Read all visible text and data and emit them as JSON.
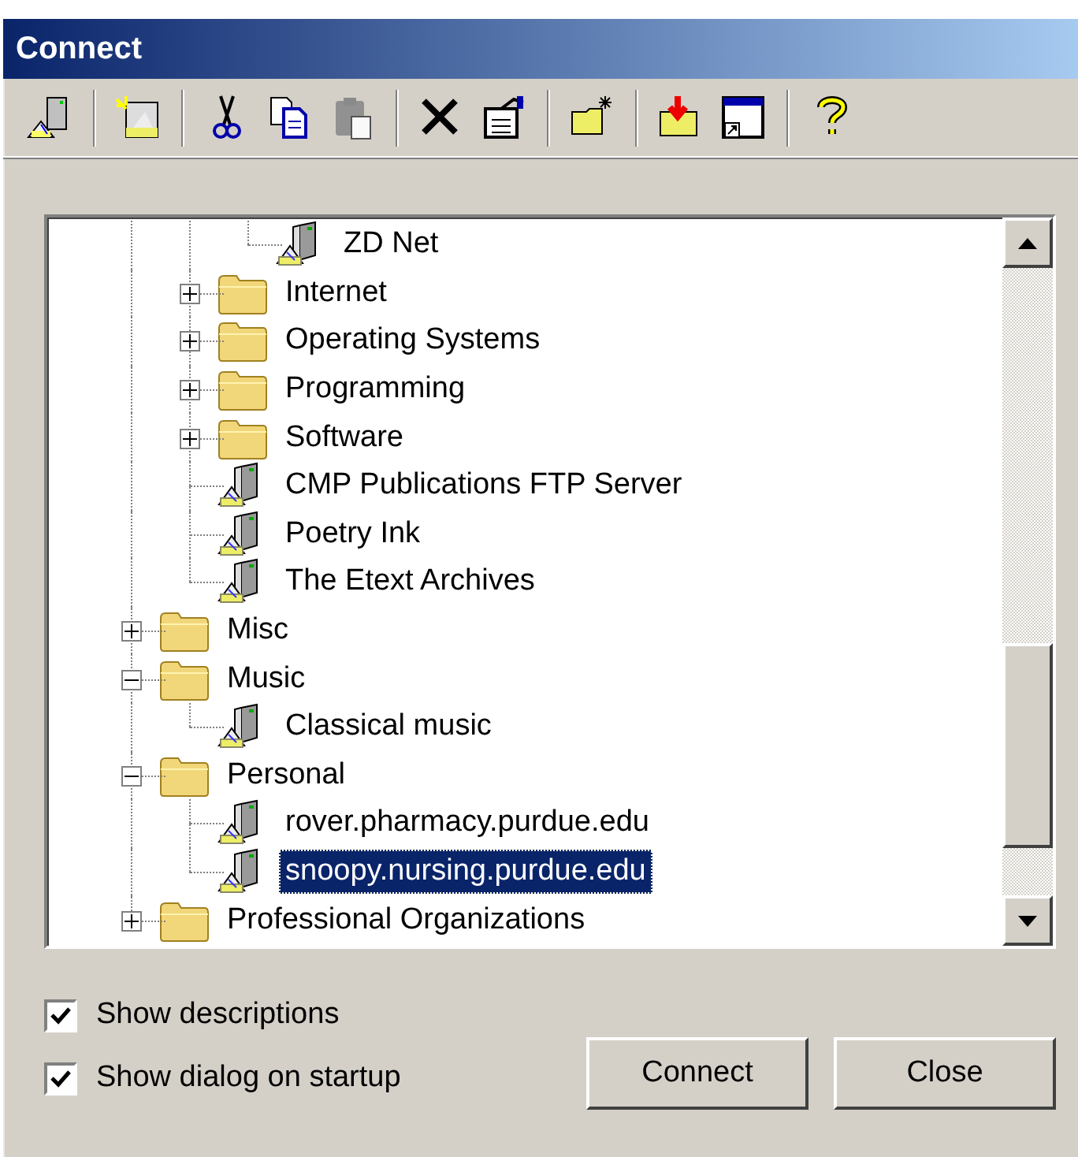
{
  "window": {
    "title": "Connect"
  },
  "toolbar": [
    {
      "kind": "server",
      "disabled": false
    },
    {
      "kind": "separator"
    },
    {
      "kind": "new-server",
      "disabled": false
    },
    {
      "kind": "separator"
    },
    {
      "kind": "cut",
      "disabled": false
    },
    {
      "kind": "copy",
      "disabled": false
    },
    {
      "kind": "paste",
      "disabled": true
    },
    {
      "kind": "separator"
    },
    {
      "kind": "delete",
      "disabled": false
    },
    {
      "kind": "properties",
      "disabled": false
    },
    {
      "kind": "separator"
    },
    {
      "kind": "new-folder",
      "disabled": false
    },
    {
      "kind": "separator"
    },
    {
      "kind": "import",
      "disabled": false
    },
    {
      "kind": "shortcut",
      "disabled": false
    },
    {
      "kind": "separator"
    },
    {
      "kind": "help",
      "disabled": false
    }
  ],
  "tree": {
    "items": [
      {
        "kind": "continued",
        "children": [
          {
            "kind": "continued",
            "children": [
              {
                "kind": "server",
                "label": "ZD Net",
                "selected": false
              }
            ]
          },
          {
            "kind": "folder",
            "label": "Internet",
            "expanded": false,
            "selected": false
          },
          {
            "kind": "folder",
            "label": "Operating Systems",
            "expanded": false,
            "selected": false
          },
          {
            "kind": "folder",
            "label": "Programming",
            "expanded": false,
            "selected": false
          },
          {
            "kind": "folder",
            "label": "Software",
            "expanded": false,
            "selected": false
          },
          {
            "kind": "server",
            "label": "CMP Publications FTP Server",
            "selected": false
          },
          {
            "kind": "server",
            "label": "Poetry Ink",
            "selected": false
          },
          {
            "kind": "server",
            "label": "The Etext Archives",
            "selected": false
          }
        ]
      },
      {
        "kind": "folder",
        "label": "Misc",
        "expanded": false,
        "selected": false
      },
      {
        "kind": "folder",
        "label": "Music",
        "expanded": true,
        "selected": false,
        "children": [
          {
            "kind": "server",
            "label": "Classical music",
            "selected": false
          }
        ]
      },
      {
        "kind": "folder",
        "label": "Personal",
        "expanded": true,
        "selected": false,
        "children": [
          {
            "kind": "server",
            "label": "rover.pharmacy.purdue.edu",
            "selected": false
          },
          {
            "kind": "server",
            "label": "snoopy.nursing.purdue.edu",
            "selected": true
          }
        ]
      },
      {
        "kind": "folder",
        "label": "Professional Organizations",
        "expanded": false,
        "selected": false
      }
    ]
  },
  "options": [
    {
      "label": "Show descriptions",
      "checked": true
    },
    {
      "label": "Show dialog on startup",
      "checked": true
    }
  ],
  "buttons": [
    "Connect",
    "Close"
  ]
}
